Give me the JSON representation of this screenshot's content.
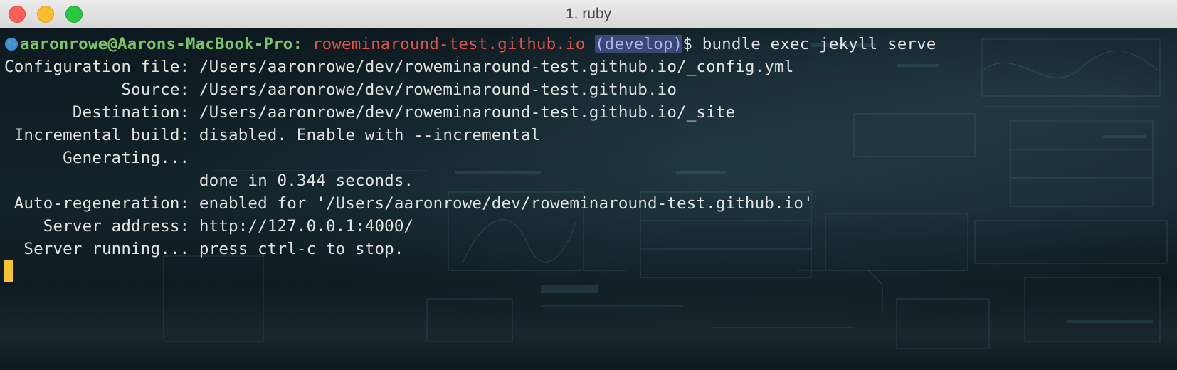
{
  "window": {
    "title": "1. ruby",
    "traffic_lights": [
      {
        "name": "close",
        "color": "#fc5f57"
      },
      {
        "name": "minimize",
        "color": "#fdbc2e"
      },
      {
        "name": "zoom",
        "color": "#28c840"
      }
    ]
  },
  "terminal": {
    "prompt": {
      "icon": "globe-icon",
      "user_host": "aaronrowe@Aarons-MacBook-Pro:",
      "directory": "roweminaround-test.github.io",
      "branch": "(develop)",
      "symbol": "$",
      "command": "bundle exec jekyll serve"
    },
    "output": [
      "Configuration file: /Users/aaronrowe/dev/roweminaround-test.github.io/_config.yml",
      "            Source: /Users/aaronrowe/dev/roweminaround-test.github.io",
      "       Destination: /Users/aaronrowe/dev/roweminaround-test.github.io/_site",
      " Incremental build: disabled. Enable with --incremental",
      "      Generating...",
      "                    done in 0.344 seconds.",
      " Auto-regeneration: enabled for '/Users/aaronrowe/dev/roweminaround-test.github.io'",
      "    Server address: http://127.0.0.1:4000/",
      "  Server running... press ctrl-c to stop."
    ],
    "colors": {
      "user": "#7cc46a",
      "directory": "#e2514a",
      "branch_bg": "#3a4875",
      "cursor": "#f7c230",
      "text": "#e2e2e2"
    }
  }
}
